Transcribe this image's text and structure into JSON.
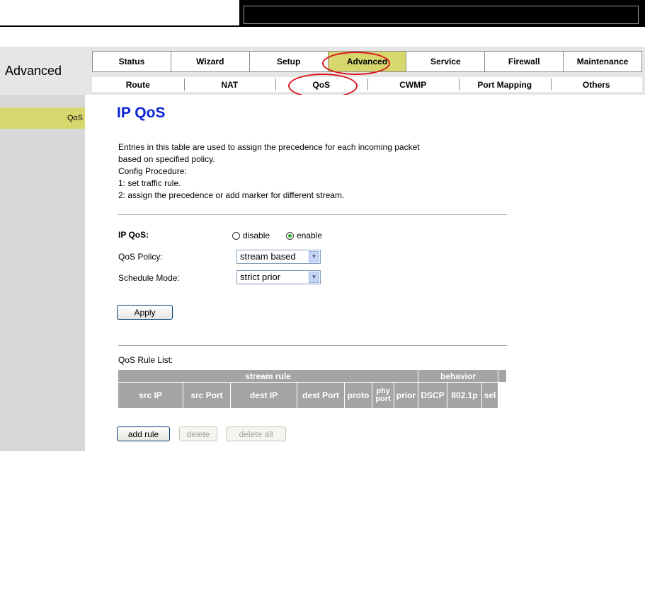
{
  "nav": {
    "section_title": "Advanced",
    "main_tabs": [
      {
        "label": "Status"
      },
      {
        "label": "Wizard"
      },
      {
        "label": "Setup"
      },
      {
        "label": "Advanced",
        "active": true
      },
      {
        "label": "Service"
      },
      {
        "label": "Firewall"
      },
      {
        "label": "Maintenance"
      }
    ],
    "sub_tabs": [
      {
        "label": "Route"
      },
      {
        "label": "NAT"
      },
      {
        "label": "QoS",
        "active": true
      },
      {
        "label": "CWMP"
      },
      {
        "label": "Port Mapping"
      },
      {
        "label": "Others"
      }
    ]
  },
  "sidebar": {
    "items": [
      {
        "label": "QoS",
        "active": true
      }
    ]
  },
  "page": {
    "title": "IP QoS",
    "description": [
      "Entries in this table are used to assign the precedence for each incoming packet",
      "based on specified policy.",
      "Config Procedure:",
      "1: set traffic rule.",
      "2: assign the precedence or add marker for different stream."
    ]
  },
  "form": {
    "ip_qos_label": "IP QoS:",
    "option_disable": "disable",
    "option_enable": "enable",
    "selected": "enable",
    "policy_label": "QoS Policy:",
    "policy_value": "stream based",
    "schedule_label": "Schedule Mode:",
    "schedule_value": "strict prior",
    "apply_label": "Apply"
  },
  "rule_list": {
    "title": "QoS Rule List:",
    "group_headers": [
      "stream rule",
      "behavior"
    ],
    "columns": [
      "src IP",
      "src Port",
      "dest IP",
      "dest Port",
      "proto",
      "phy",
      "port",
      "prior",
      "DSCP",
      "802.1p",
      "sel"
    ]
  },
  "actions": {
    "add": "add rule",
    "delete": "delete",
    "delete_all": "delete all"
  },
  "colors": {
    "active_tab": "#d7d76e",
    "title_blue": "#0b24d4",
    "highlight_circle": "#d8141b",
    "table_header": "#a4a4a4"
  }
}
